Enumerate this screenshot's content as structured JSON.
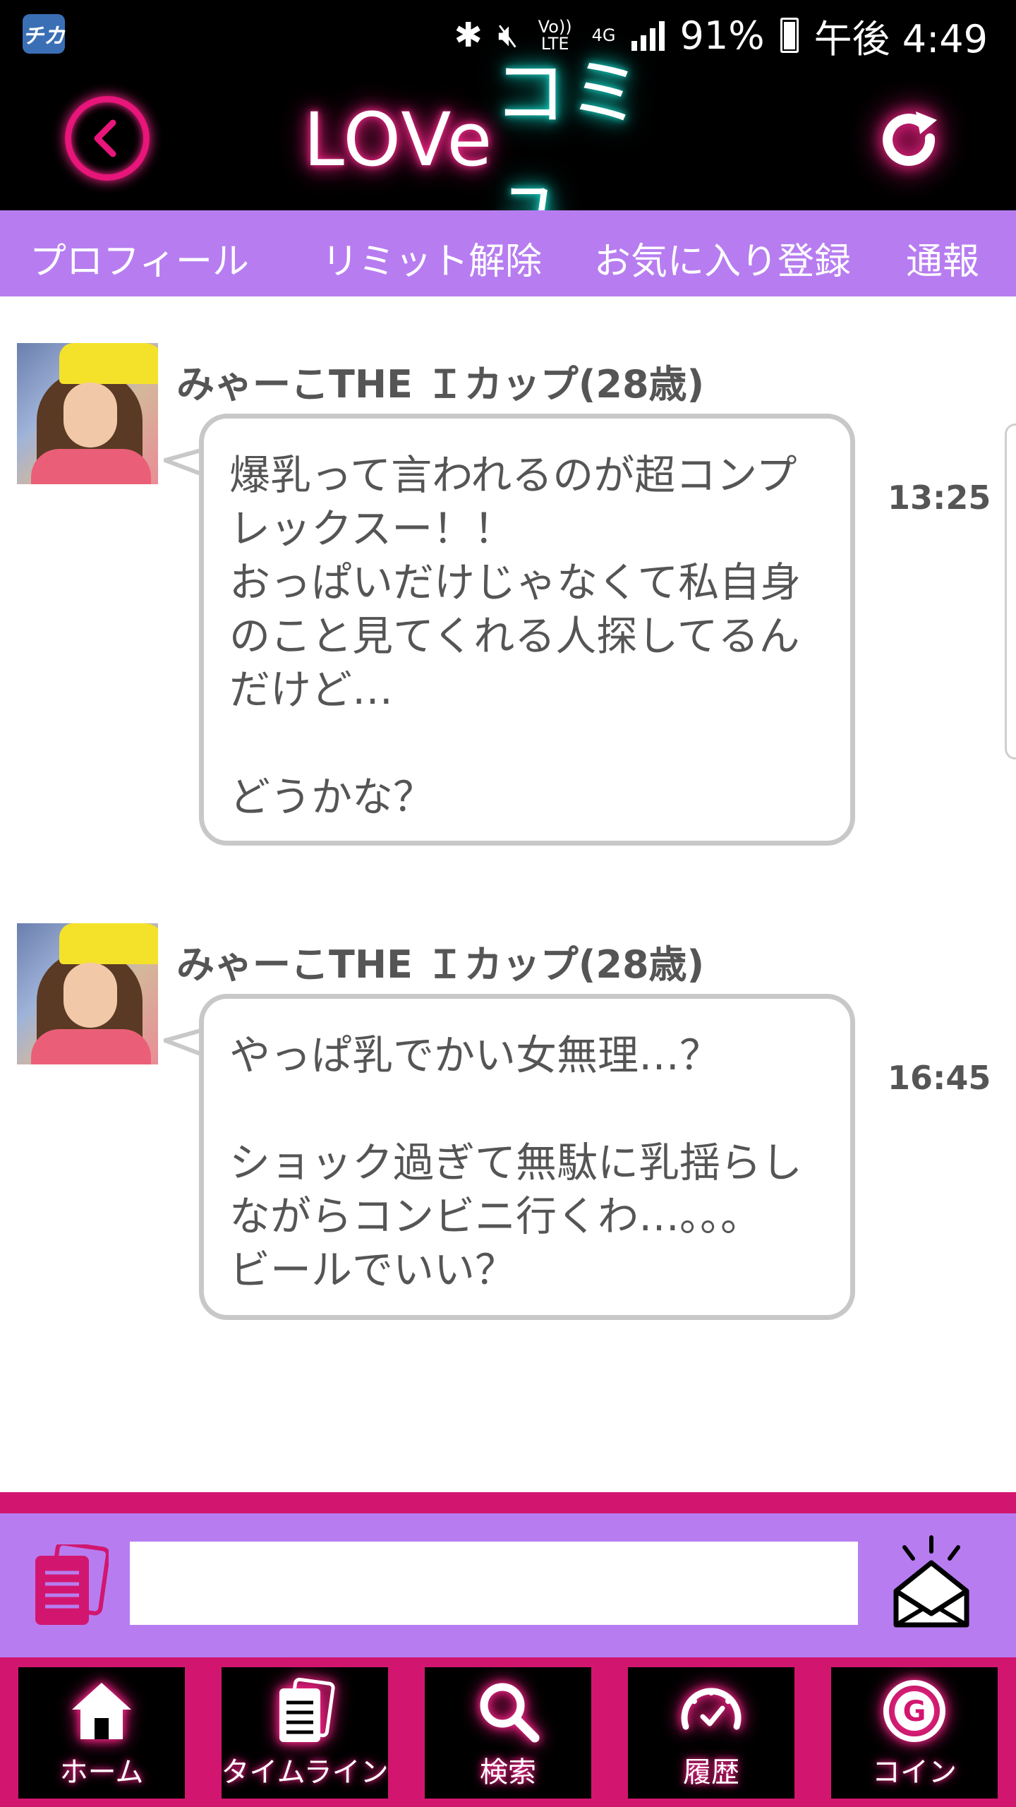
{
  "status_bar": {
    "notif_app": "チカ",
    "network_volte": "Vo)) LTE",
    "network_4g": "4G",
    "battery": "91%",
    "time": "午後 4:49"
  },
  "header": {
    "logo_part1": "LOVe",
    "logo_part2": "コミュ"
  },
  "sub_nav": {
    "items": [
      "プロフィール",
      "リミット解除",
      "お気に入り登録",
      "通報"
    ]
  },
  "messages": [
    {
      "sender": "みゃーこTHE Ｉカップ(28歳)",
      "lines": [
        "爆乳って言われるのが超コンプ",
        "レックスー！！",
        "おっぱいだけじゃなくて私自身",
        "のこと見てくれる人探してるん",
        "だけど…",
        "",
        "どうかな？"
      ],
      "time": "13:25"
    },
    {
      "sender": "みゃーこTHE Ｉカップ(28歳)",
      "lines": [
        "やっぱ乳でかい女無理…？",
        "",
        "ショック過ぎて無駄に乳揺らし",
        "ながらコンビニ行くわ…。。。",
        "ビールでいい？"
      ],
      "time": "16:45"
    }
  ],
  "compose": {
    "input_value": "",
    "input_placeholder": ""
  },
  "tab_bar": {
    "items": [
      {
        "label": "ホーム",
        "icon": "home-icon"
      },
      {
        "label": "タイムライン",
        "icon": "timeline-icon"
      },
      {
        "label": "検索",
        "icon": "search-icon"
      },
      {
        "label": "履歴",
        "icon": "history-icon"
      },
      {
        "label": "コイン",
        "icon": "coin-icon"
      }
    ]
  },
  "colors": {
    "accent_pink": "#d2166f",
    "neon_pink": "#ff2b8f",
    "neon_cyan": "#19e0d0",
    "lavender": "#b77df0"
  }
}
